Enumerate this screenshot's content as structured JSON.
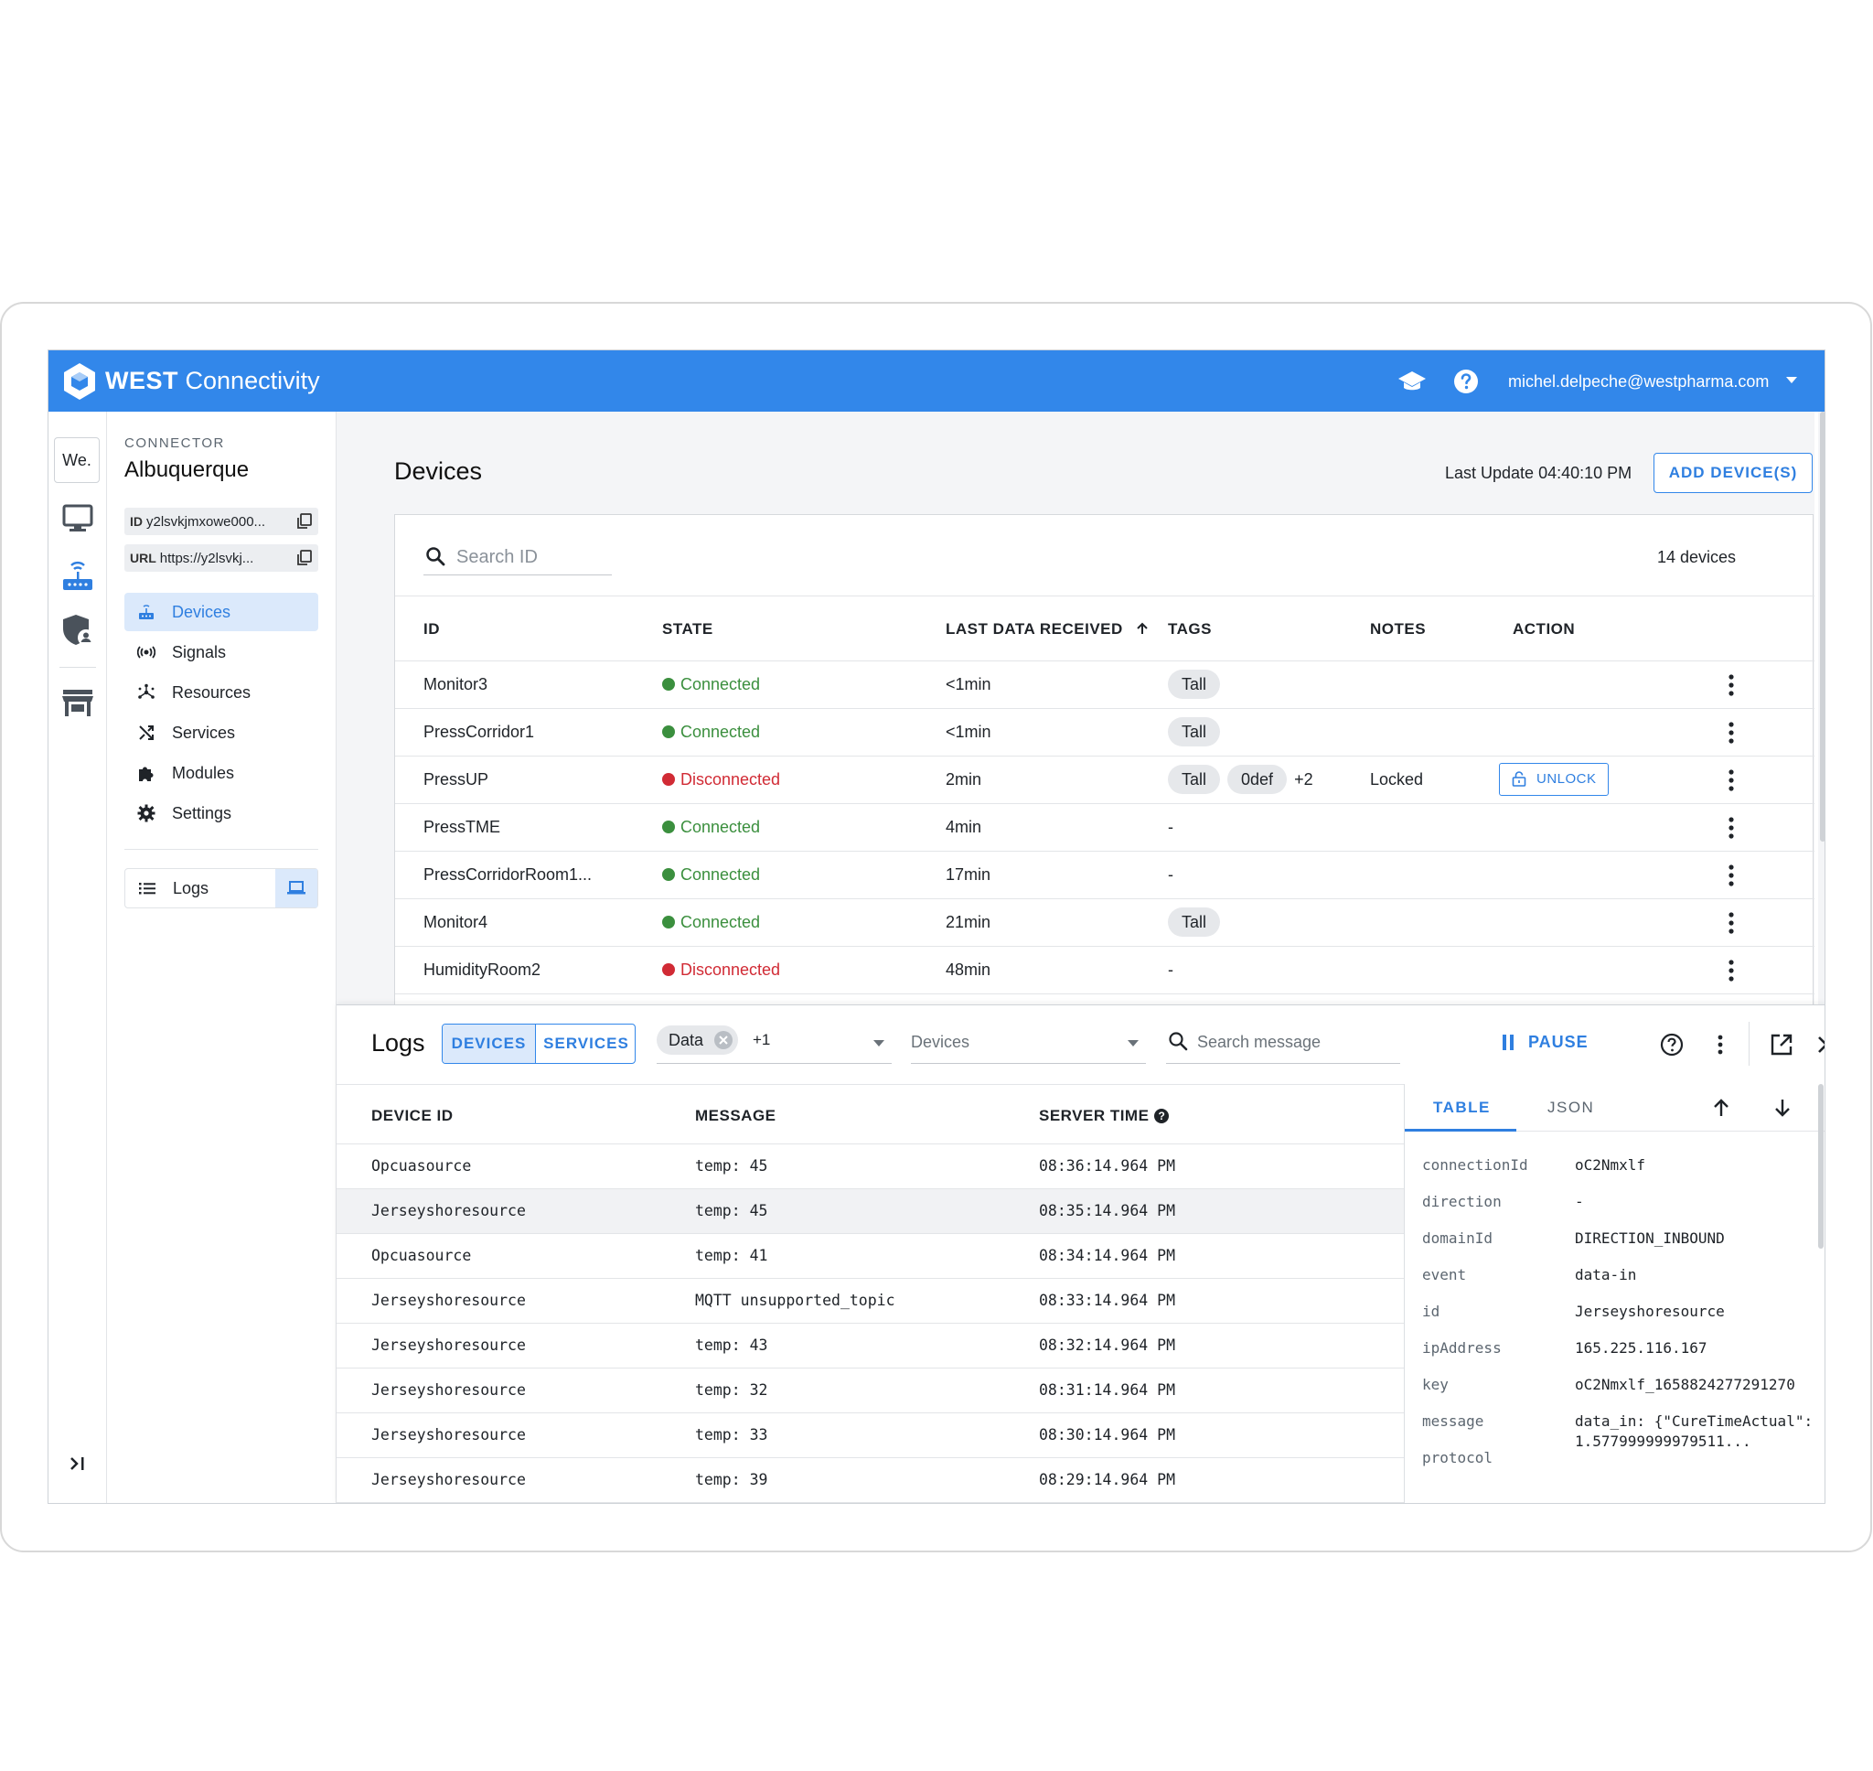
{
  "brand": {
    "bold": "WEST",
    "regular": "Connectivity"
  },
  "topbar": {
    "user": "michel.delpeche@westpharma.com",
    "learn_icon": "graduation-cap-icon",
    "help_icon": "question-circle-icon"
  },
  "rail": {
    "workspace": "We."
  },
  "connector": {
    "label": "CONNECTOR",
    "name": "Albuquerque",
    "id_label": "ID",
    "id_value": "y2lsvkjmxowe000...",
    "url_label": "URL",
    "url_value": "https://y2lsvkj..."
  },
  "nav": [
    {
      "label": "Devices",
      "icon": "router-icon",
      "active": true
    },
    {
      "label": "Signals",
      "icon": "signals-icon"
    },
    {
      "label": "Resources",
      "icon": "resources-icon"
    },
    {
      "label": "Services",
      "icon": "shuffle-icon"
    },
    {
      "label": "Modules",
      "icon": "puzzle-icon"
    },
    {
      "label": "Settings",
      "icon": "gear-icon"
    }
  ],
  "logs_nav": {
    "label": "Logs"
  },
  "devices": {
    "title": "Devices",
    "last_update": "Last Update 04:40:10 PM",
    "add_button": "ADD DEVICE(S)",
    "search_placeholder": "Search ID",
    "count": "14 devices",
    "columns": [
      "ID",
      "STATE",
      "LAST DATA RECEIVED",
      "TAGS",
      "NOTES",
      "ACTION"
    ],
    "rows": [
      {
        "id": "Monitor3",
        "state": "Connected",
        "last": "<1min",
        "tags": [
          "Tall"
        ],
        "extra": "",
        "notes": "",
        "action": ""
      },
      {
        "id": "PressCorridor1",
        "state": "Connected",
        "last": "<1min",
        "tags": [
          "Tall"
        ],
        "extra": "",
        "notes": "",
        "action": ""
      },
      {
        "id": "PressUP",
        "state": "Disconnected",
        "last": "2min",
        "tags": [
          "Tall",
          "0def"
        ],
        "extra": "+2",
        "notes": "Locked",
        "action": "UNLOCK"
      },
      {
        "id": "PressTME",
        "state": "Connected",
        "last": "4min",
        "tags": [],
        "extra": "-",
        "notes": "",
        "action": ""
      },
      {
        "id": "PressCorridorRoom1...",
        "state": "Connected",
        "last": "17min",
        "tags": [],
        "extra": "-",
        "notes": "",
        "action": ""
      },
      {
        "id": "Monitor4",
        "state": "Connected",
        "last": "21min",
        "tags": [
          "Tall"
        ],
        "extra": "",
        "notes": "",
        "action": ""
      },
      {
        "id": "HumidityRoom2",
        "state": "Disconnected",
        "last": "48min",
        "tags": [],
        "extra": "-",
        "notes": "",
        "action": ""
      }
    ],
    "state_colors": {
      "Connected": "#3b8f3e",
      "Disconnected": "#d12b35"
    }
  },
  "logs": {
    "title": "Logs",
    "seg_devices": "DEVICES",
    "seg_services": "SERVICES",
    "filter_chip": "Data",
    "filter_more": "+1",
    "devices_select": "Devices",
    "search_placeholder": "Search message",
    "pause": "PAUSE",
    "columns": [
      "DEVICE ID",
      "MESSAGE",
      "SERVER TIME"
    ],
    "rows": [
      {
        "device": "Opcuasource",
        "message": "temp: 45",
        "time": "08:36:14.964 PM"
      },
      {
        "device": "Jerseyshoresource",
        "message": "temp: 45",
        "time": "08:35:14.964 PM"
      },
      {
        "device": "Opcuasource",
        "message": "temp: 41",
        "time": "08:34:14.964 PM"
      },
      {
        "device": "Jerseyshoresource",
        "message": "MQTT unsupported_topic",
        "time": "08:33:14.964 PM"
      },
      {
        "device": "Jerseyshoresource",
        "message": "temp: 43",
        "time": "08:32:14.964 PM"
      },
      {
        "device": "Jerseyshoresource",
        "message": "temp: 32",
        "time": "08:31:14.964 PM"
      },
      {
        "device": "Jerseyshoresource",
        "message": "temp: 33",
        "time": "08:30:14.964 PM"
      },
      {
        "device": "Jerseyshoresource",
        "message": "temp: 39",
        "time": "08:29:14.964 PM"
      }
    ],
    "detail": {
      "tab_table": "TABLE",
      "tab_json": "JSON",
      "fields": [
        {
          "k": "connectionId",
          "v": "oC2Nmxlf"
        },
        {
          "k": "direction",
          "v": "-"
        },
        {
          "k": "domainId",
          "v": "DIRECTION_INBOUND"
        },
        {
          "k": "event",
          "v": "data-in"
        },
        {
          "k": "id",
          "v": "Jerseyshoresource"
        },
        {
          "k": "ipAddress",
          "v": "165.225.116.167"
        },
        {
          "k": "key",
          "v": "oC2Nmxlf_1658824277291270"
        },
        {
          "k": "message",
          "v": "data_in: {\"CureTimeActual\":1.577999999979511..."
        },
        {
          "k": "protocol",
          "v": ""
        }
      ]
    }
  }
}
